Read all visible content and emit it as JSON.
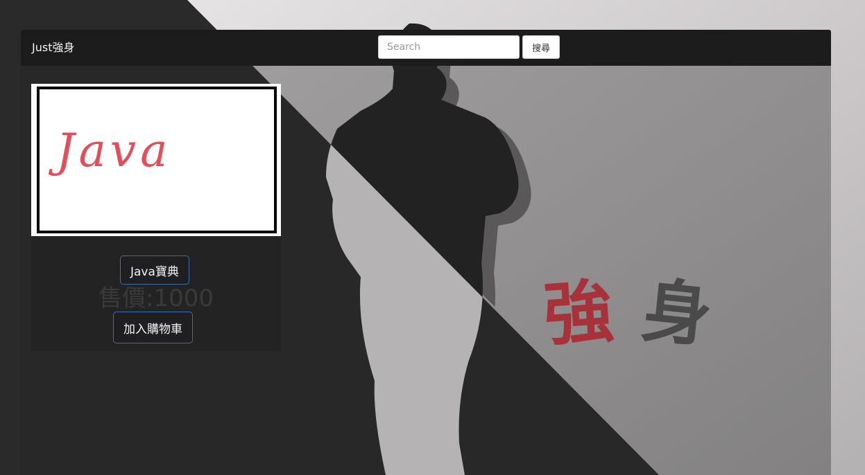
{
  "navbar": {
    "brand": "Just強身",
    "search": {
      "placeholder": "Search",
      "value": "",
      "button_label": "搜尋"
    }
  },
  "product": {
    "image_text": "Java",
    "name": "Java寶典",
    "price": "售價:1000",
    "cart_label": "加入購物車"
  },
  "background": {
    "calligraphy": [
      "強",
      "身"
    ],
    "colors": {
      "calligraphy_red": "#a8323a",
      "calligraphy_gray": "#4a4a4a",
      "silhouette": "#232223"
    }
  }
}
